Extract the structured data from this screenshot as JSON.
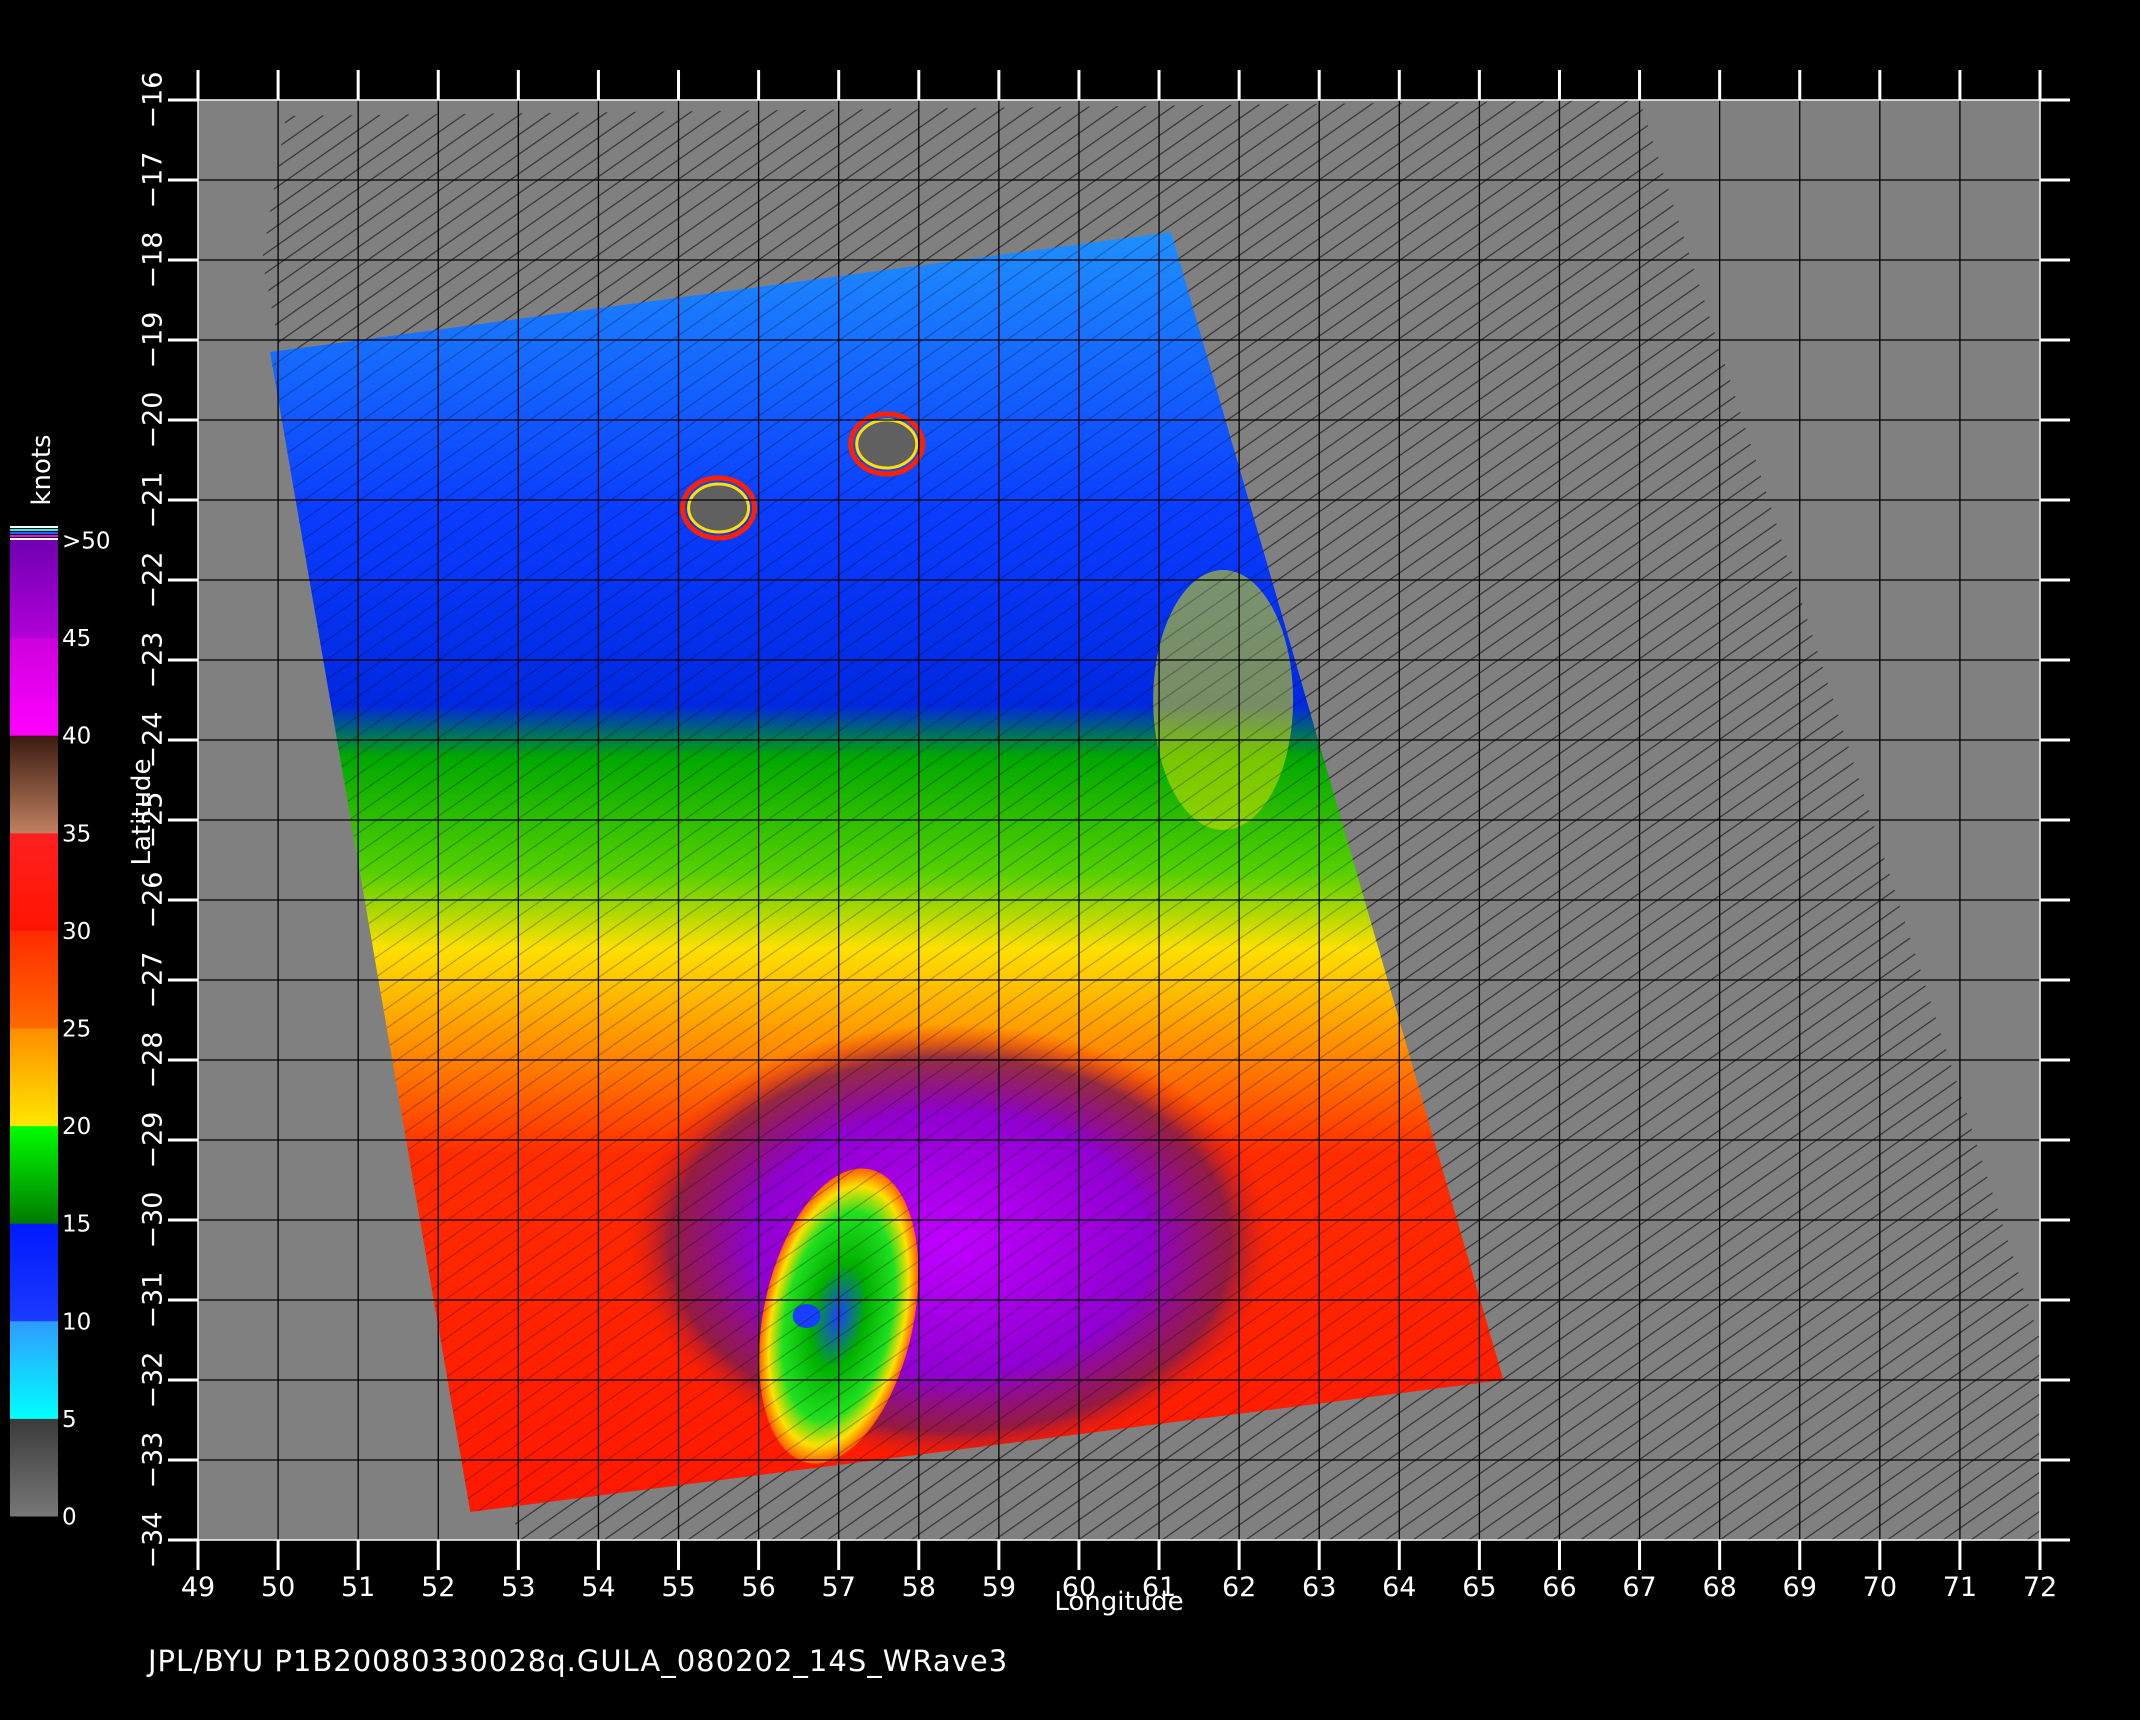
{
  "map": {
    "axes": {
      "x_label": "Longitude",
      "y_label": "Latitude",
      "x_ticks": [
        "49",
        "50",
        "51",
        "52",
        "53",
        "54",
        "55",
        "56",
        "57",
        "58",
        "59",
        "60",
        "61",
        "62",
        "63",
        "64",
        "65",
        "66",
        "67",
        "68",
        "69",
        "70",
        "71",
        "72"
      ],
      "y_ticks": [
        "−16",
        "−17",
        "−18",
        "−19",
        "−20",
        "−21",
        "−22",
        "−23",
        "−24",
        "−25",
        "−26",
        "−27",
        "−28",
        "−29",
        "−30",
        "−31",
        "−32",
        "−33",
        "−34"
      ],
      "lon_range": [
        49,
        72
      ],
      "lat_range": [
        -16,
        -34
      ],
      "grid": true
    },
    "colorbar": {
      "title": "knots",
      "orientation": "vertical",
      "labels": [
        "0",
        "5",
        "10",
        "15",
        "20",
        "25",
        "30",
        "35",
        "40",
        "45",
        ">50"
      ],
      "bands": [
        {
          "range": "0-5",
          "colors": [
            "#777777",
            "#3a3a3a"
          ]
        },
        {
          "range": "5-10",
          "colors": [
            "#00ffff",
            "#2f9bff"
          ]
        },
        {
          "range": "10-15",
          "colors": [
            "#1a3cff",
            "#0018ff"
          ]
        },
        {
          "range": "15-20",
          "colors": [
            "#007a00",
            "#00ff00"
          ]
        },
        {
          "range": "20-25",
          "colors": [
            "#ffe600",
            "#ff8c00"
          ]
        },
        {
          "range": "25-30",
          "colors": [
            "#ff6a00",
            "#ff2a00"
          ]
        },
        {
          "range": "30-35",
          "colors": [
            "#ff1500",
            "#ff2020"
          ]
        },
        {
          "range": "35-40",
          "colors": [
            "#c08060",
            "#3a1a10"
          ]
        },
        {
          "range": "40-45",
          "colors": [
            "#ff00ff",
            "#cc00dd"
          ]
        },
        {
          "range": "45-50",
          "colors": [
            "#b000d8",
            "#7000b0"
          ]
        }
      ]
    },
    "footer": "JPL/BYU  P1B20080330028q.GULA_080202_14S_WRave3",
    "colors": {
      "background": "#000000",
      "land_no_data": "#808080",
      "grid": "#000000",
      "calm": "#0a33ff",
      "moderate": "#00c000",
      "strong": "#ff2200",
      "storm": "#9900dd",
      "eye": "#1a40ff"
    },
    "features": [
      {
        "name": "island",
        "lon": 55.5,
        "lat": -21.1
      },
      {
        "name": "island",
        "lon": 57.6,
        "lat": -20.3
      },
      {
        "name": "storm-eye",
        "lon": 56.7,
        "lat": -31.2
      }
    ]
  }
}
